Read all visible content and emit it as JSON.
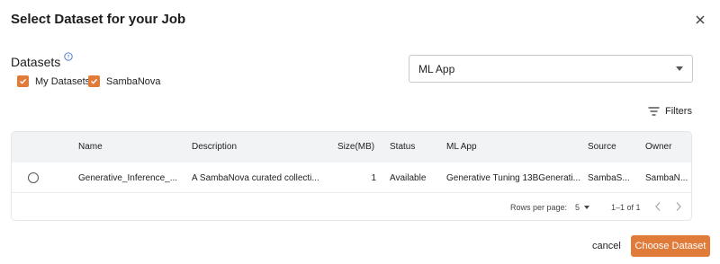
{
  "dialog": {
    "title": "Select Dataset for your Job",
    "datasets_label": "Datasets"
  },
  "checkboxes": [
    {
      "label": "My Datasets",
      "checked": true
    },
    {
      "label": "SambaNova",
      "checked": true
    }
  ],
  "ml_app_select": {
    "value": "ML App"
  },
  "filters_label": "Filters",
  "table": {
    "columns": [
      "Name",
      "Description",
      "Size(MB)",
      "Status",
      "ML App",
      "Source",
      "Owner"
    ],
    "rows": [
      {
        "name": "Generative_Inference_...",
        "description": "A SambaNova curated collecti...",
        "size": "1",
        "status": "Available",
        "ml_app": "Generative Tuning 13BGenerati...",
        "source": "SambaS...",
        "owner": "SambaN..."
      }
    ]
  },
  "pagination": {
    "rows_per_page_label": "Rows per page:",
    "rows_per_page_value": "5",
    "range": "1–1 of 1"
  },
  "actions": {
    "cancel": "cancel",
    "choose": "Choose Dataset"
  },
  "colors": {
    "accent": "#e07b39",
    "header_bg": "#f1f3f4"
  }
}
